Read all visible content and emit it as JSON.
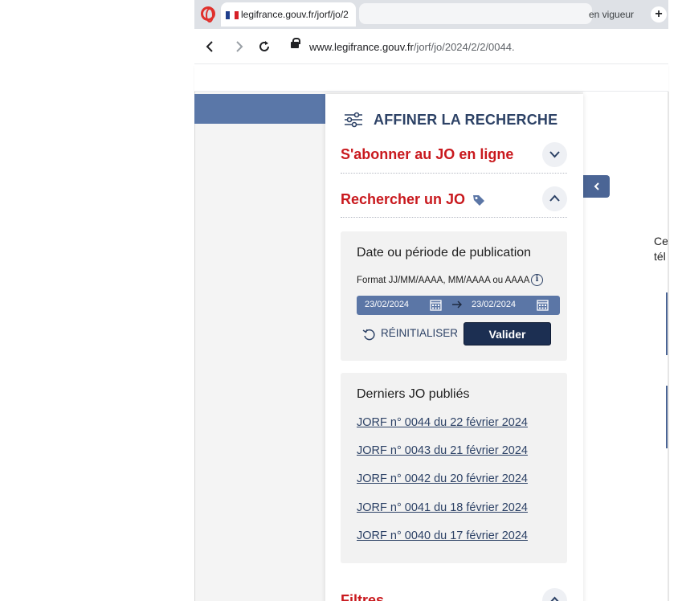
{
  "browser": {
    "tab_title": "legifrance.gouv.fr/jorf/jo/2",
    "tab_right_title": "en vigueur",
    "new_tab": "+",
    "url_domain": "www.legifrance.gouv.fr",
    "url_path": "/jorf/jo/2024/2/2/0044."
  },
  "panel": {
    "title": "AFFINER LA RECHERCHE",
    "subscribe": {
      "label": "S'abonner au JO en ligne",
      "state": "collapsed"
    },
    "search_jo": {
      "label": "Rechercher un JO",
      "state": "expanded"
    },
    "filters_label": "Filtres"
  },
  "date_card": {
    "title": "Date ou période de publication",
    "format_hint": "Format JJ/MM/AAAA, MM/AAAA ou AAAA",
    "start_date": "23/02/2024",
    "end_date": "23/02/2024",
    "reset_label": "RÉINITIALISER",
    "submit_label": "Valider"
  },
  "latest": {
    "title": "Derniers JO publiés",
    "items": [
      "JORF n° 0044 du 22 février 2024",
      "JORF n° 0043 du 21 février 2024",
      "JORF n° 0042 du 20 février 2024",
      "JORF n° 0041 du 18 février 2024",
      "JORF n° 0040 du 17 février 2024"
    ]
  },
  "right_text": {
    "line1": "Ce",
    "line2": "tél"
  },
  "colors": {
    "brand_red": "#c9191e",
    "navy": "#2d4266",
    "button_dark": "#1c2f52",
    "date_field": "#5b76a6",
    "band": "#5a77a8"
  },
  "icons": [
    "opera-icon",
    "flag-icon",
    "back-icon",
    "forward-icon",
    "reload-icon",
    "lock-icon",
    "filter-sliders-icon",
    "chevron-down-icon",
    "chevron-up-icon",
    "tag-icon",
    "info-icon",
    "calendar-icon",
    "arrow-right-icon",
    "reset-icon",
    "chevron-left-icon"
  ]
}
